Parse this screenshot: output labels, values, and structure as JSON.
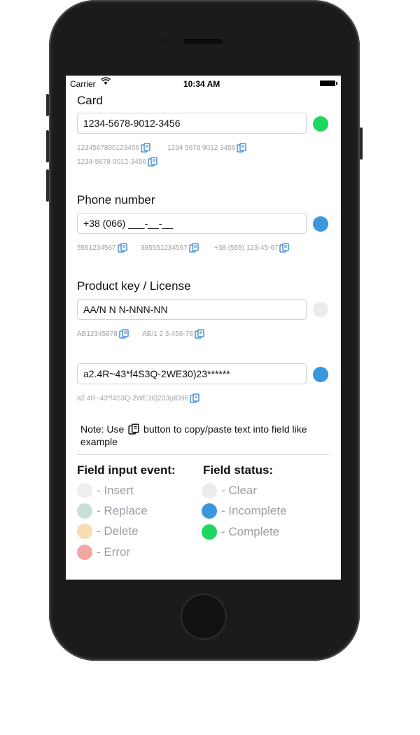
{
  "status_bar": {
    "carrier": "Carrier",
    "time": "10:34 AM"
  },
  "card": {
    "label": "Card",
    "value": "1234-5678-9012-3456",
    "status_color": "#1ed760",
    "examples": [
      "1234567890123456",
      "1234 5678 9012 3456",
      "1234-5678-9012-3456"
    ]
  },
  "phone": {
    "label": "Phone number",
    "value": "+38 (066) ___-__-__",
    "status_color": "#3a96dd",
    "examples": [
      "5551234567",
      "385551234567",
      "+38 (555) 123-45-67"
    ]
  },
  "product_key": {
    "label": "Product key / License",
    "value": "AA/N N N-NNN-NN",
    "status_color": "#ececec",
    "examples": [
      "AB12345678",
      "AB/1 2 3-456-78"
    ]
  },
  "custom": {
    "value": "a2.4R~43*f4S3Q-2WE30)23******",
    "status_color": "#3a96dd",
    "examples": [
      "a2.4R~43*f4S3Q-2WE30)233(dD96"
    ]
  },
  "note": {
    "before": "Note: Use",
    "after": "button to copy/paste text into field like example"
  },
  "input_events": {
    "title": "Field input event:",
    "items": [
      {
        "label": "- Insert",
        "color": "#eeeeee"
      },
      {
        "label": "- Replace",
        "color": "#c8e0da"
      },
      {
        "label": "- Delete",
        "color": "#f7dcb4"
      },
      {
        "label": "- Error",
        "color": "#f2a8a0"
      }
    ]
  },
  "field_status": {
    "title": "Field status:",
    "items": [
      {
        "label": "- Clear",
        "color": "#ececec"
      },
      {
        "label": "- Incomplete",
        "color": "#3a96dd"
      },
      {
        "label": "- Complete",
        "color": "#1ed760"
      }
    ]
  }
}
